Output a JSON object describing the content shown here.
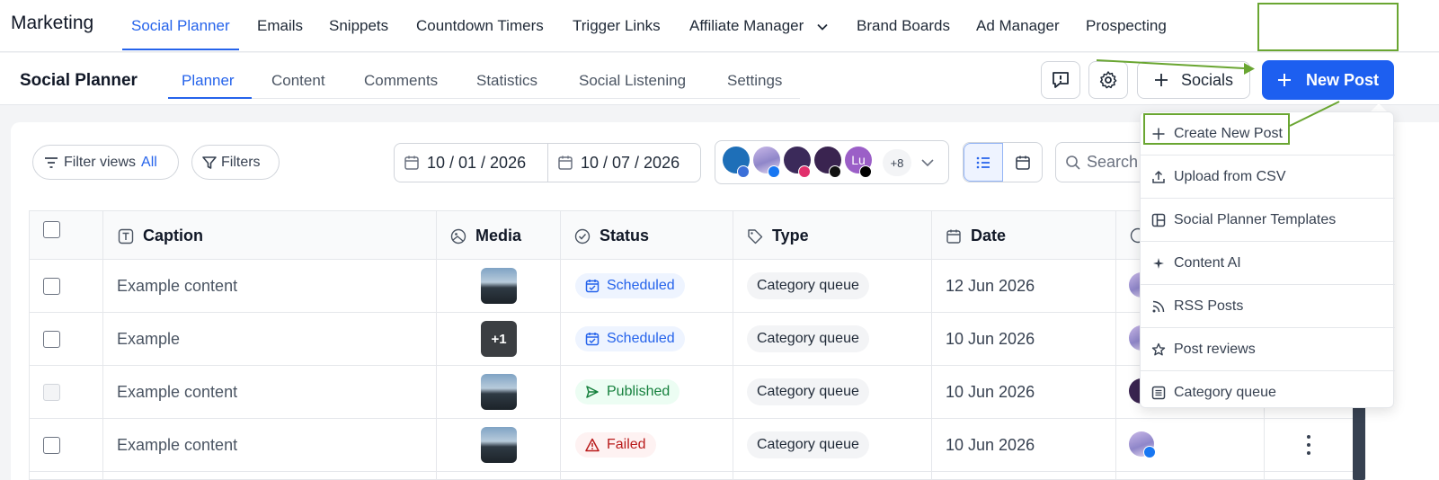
{
  "app": {
    "brand": "Marketing"
  },
  "topnav": {
    "items": [
      "Social Planner",
      "Emails",
      "Snippets",
      "Countdown Timers",
      "Trigger Links",
      "Affiliate Manager",
      "Brand Boards",
      "Ad Manager",
      "Prospecting"
    ],
    "active": "Social Planner"
  },
  "subheader": {
    "title": "Social Planner",
    "tabs": [
      "Planner",
      "Content",
      "Comments",
      "Statistics",
      "Social Listening",
      "Settings"
    ],
    "active_tab": "Planner",
    "socials_label": "Socials",
    "new_post_label": "New Post"
  },
  "toolbar": {
    "filter_views_label": "Filter views",
    "filter_views_value": "All",
    "filters_label": "Filters",
    "date_start": "10 / 01 / 2026",
    "date_end": "10 / 07 / 2026",
    "accounts_more": "+8",
    "account_initials": "Lu",
    "search_placeholder": "Search"
  },
  "table": {
    "columns": [
      "Caption",
      "Media",
      "Status",
      "Type",
      "Date"
    ],
    "rows": [
      {
        "caption": "Example content",
        "media_count": "",
        "status": "Scheduled",
        "type": "Category queue",
        "date": "12 Jun 2026"
      },
      {
        "caption": "Example",
        "media_count": "+1",
        "status": "Scheduled",
        "type": "Category queue",
        "date": "10 Jun 2026"
      },
      {
        "caption": "Example content",
        "media_count": "",
        "status": "Published",
        "type": "Category queue",
        "date": "10 Jun 2026"
      },
      {
        "caption": "Example content",
        "media_count": "",
        "status": "Failed",
        "type": "Category queue",
        "date": "10 Jun 2026"
      }
    ]
  },
  "dropdown": {
    "items": [
      "Create New Post",
      "Upload from CSV",
      "Social Planner Templates",
      "Content AI",
      "RSS Posts",
      "Post reviews",
      "Category queue"
    ]
  },
  "colors": {
    "accent": "#2563eb",
    "primary_button": "#1d5ff0",
    "annotation": "#6aa632"
  }
}
